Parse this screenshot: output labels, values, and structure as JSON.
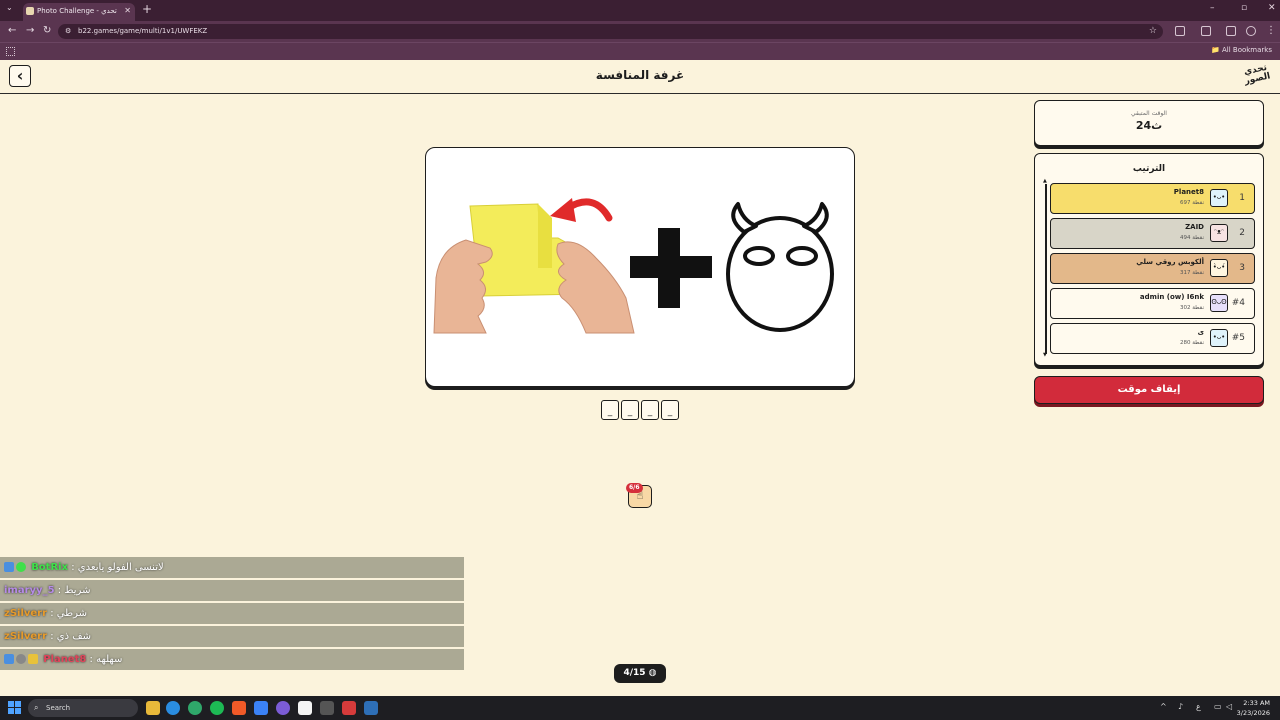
{
  "browser": {
    "tab_title": "Photo Challenge - تحدي الصور",
    "url": "b22.games/game/multi/1v1/UWFEKZ",
    "all_bookmarks": "All Bookmarks"
  },
  "header": {
    "title": "غرفة المنافسة",
    "logo_text": "تحدي الصور"
  },
  "puzzle": {
    "slots": [
      "_",
      "_",
      "_",
      "_"
    ],
    "hint_badge": "6/6"
  },
  "timer": {
    "label": "الوقت المتبقي",
    "value": "24ث"
  },
  "ranking": {
    "title": "الترتيب",
    "players": [
      {
        "rank": "1",
        "name": "Planet8",
        "points": "697 نقطة",
        "color": "#f7dd6c",
        "avatar": "•ᴗ•"
      },
      {
        "rank": "2",
        "name": "ZAID",
        "points": "494 نقطة",
        "color": "#d8d5c8",
        "avatar": "ᵔᴥᵔ"
      },
      {
        "rank": "3",
        "name": "ألكوبس روقي سلي",
        "points": "317 نقطة",
        "color": "#e3b88a",
        "avatar": "•̀ᴗ•́"
      },
      {
        "rank": "#4",
        "name": "admin (ow) I6nk",
        "points": "302 نقطة",
        "color": "#fffaee",
        "avatar": "ʘᴗʘ"
      },
      {
        "rank": "#5",
        "name": "ى",
        "points": "280 نقطة",
        "color": "#fffaee",
        "avatar": "•ᴗ•"
      }
    ]
  },
  "stop_button": "إيقاف موقت",
  "chat": [
    {
      "name": "BotRix",
      "message": ": لاتنسى الفولو يابعدي",
      "name_color": "#3fe04a",
      "badges": [
        "#4a8fe0",
        "#3fe04a"
      ]
    },
    {
      "name": "imaryy_5",
      "message": ": شريط",
      "name_color": "#b58ae6",
      "badges": []
    },
    {
      "name": "zSilverr",
      "message": ": شرطي",
      "name_color": "#e79b2b",
      "badges": []
    },
    {
      "name": "zSilverr",
      "message": ": شف ذي",
      "name_color": "#e79b2b",
      "badges": []
    },
    {
      "name": "Planet8",
      "message": ": سهلهه",
      "name_color": "#e0445a",
      "badges": [
        "#4a8fe0",
        "#888888",
        "#e8c23a"
      ]
    }
  ],
  "round": "4/15",
  "taskbar": {
    "search": "Search",
    "time": "2:33 AM",
    "date": "3/23/2026"
  }
}
